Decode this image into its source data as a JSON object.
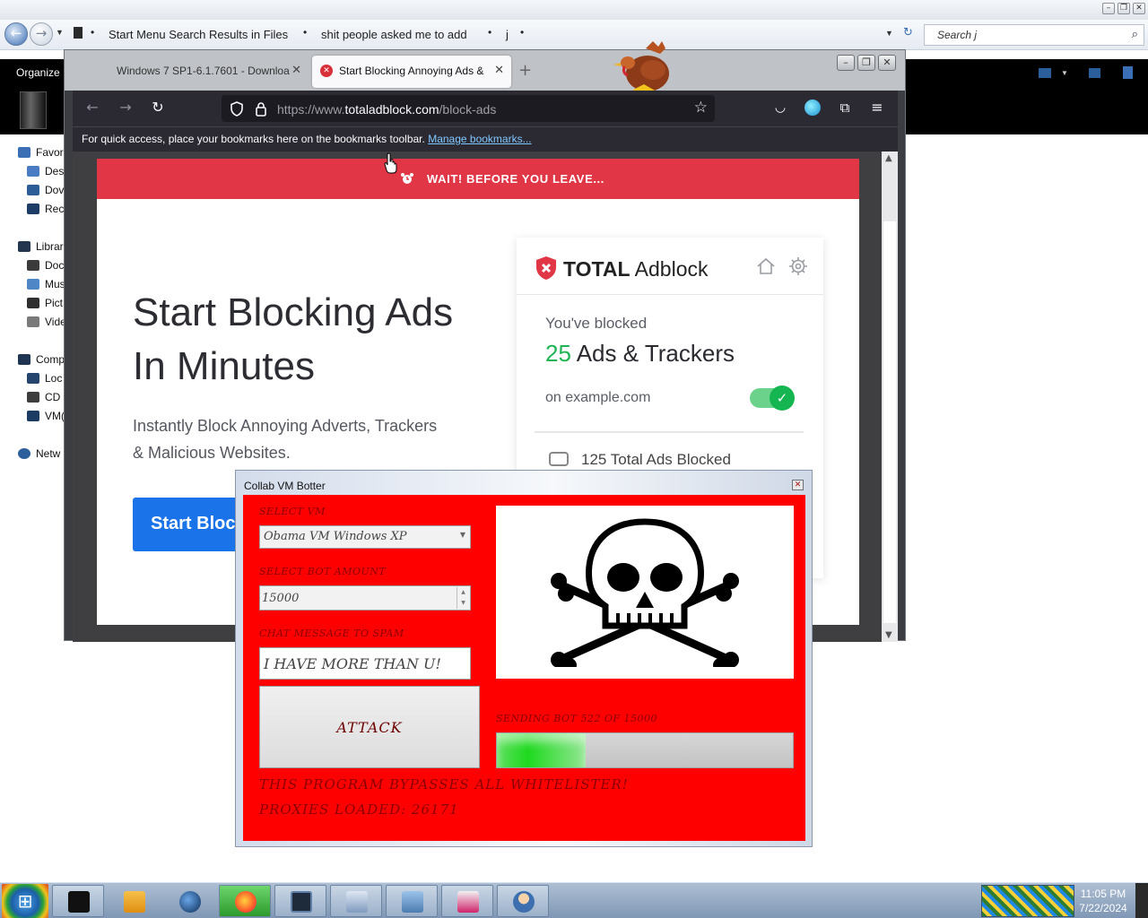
{
  "explorer": {
    "breadcrumbs": [
      "Start Menu Search Results in Files",
      "shit people asked me to add",
      "j"
    ],
    "search_placeholder": "Search j",
    "toolbar": {
      "organize_label": "Organize"
    },
    "nav_items": [
      {
        "label": "Favor",
        "color": "#3a6fb5"
      },
      {
        "label": "Des",
        "color": "#4a7cc4"
      },
      {
        "label": "Dov",
        "color": "#2d5d96"
      },
      {
        "label": "Rec",
        "color": "#1e3d66"
      },
      {
        "label": "Librar",
        "color": "#23354f"
      },
      {
        "label": "Doc",
        "color": "#3b3b3b"
      },
      {
        "label": "Mus",
        "color": "#4f86c6"
      },
      {
        "label": "Pict",
        "color": "#2f2f2f"
      },
      {
        "label": "Vide",
        "color": "#7a7a7a"
      },
      {
        "label": "Comp",
        "color": "#1f3552"
      },
      {
        "label": "Loc",
        "color": "#26456e"
      },
      {
        "label": "CD",
        "color": "#3d3d3d"
      },
      {
        "label": "VM(",
        "color": "#1b3b63"
      },
      {
        "label": "Netw",
        "color": "#2b5f9c"
      }
    ]
  },
  "firefox": {
    "tabs": [
      {
        "title": "Windows 7 SP1-6.1.7601 - Downloa"
      },
      {
        "title": "Start Blocking Annoying Ads &"
      }
    ],
    "url_prefix": "https://www.",
    "url_domain": "totaladblock.com",
    "url_path": "/block-ads",
    "bookmarks_text": "For quick access, place your bookmarks here on the bookmarks toolbar.",
    "manage_bookmarks": "Manage bookmarks..."
  },
  "webpage": {
    "banner": "WAIT! BEFORE YOU LEAVE...",
    "hero_title_line1": "Start Blocking Ads",
    "hero_title_line2": "In Minutes",
    "hero_sub_line1": "Instantly Block Annoying Adverts, Trackers",
    "hero_sub_line2": "& Malicious Websites.",
    "cta": "Start Blocking Ads",
    "panel": {
      "brand_bold": "TOTAL",
      "brand_light": "Adblock",
      "blocked_label": "You've blocked",
      "blocked_number": "25",
      "blocked_suffix": "Ads & Trackers",
      "site_label": "on example.com",
      "total_blocked": "125 Total Ads Blocked",
      "toggle_on": true
    }
  },
  "botter": {
    "title": "Collab VM Botter",
    "select_vm_label": "SELECT VM",
    "select_vm_value": "Obama VM Windows XP",
    "bot_amount_label": "SELECT BOT AMOUNT",
    "bot_amount_value": "15000",
    "chat_label": "CHAT MESSAGE TO SPAM",
    "chat_value": "I HAVE MORE THAN U!",
    "attack_label": "ATTACK",
    "sending_status": "SENDING BOT 522 OF 15000",
    "progress_fraction": 0.3,
    "bypass_text": "THIS PROGRAM BYPASSES ALL WHITELISTER!",
    "proxies_text": "PROXIES LOADED: 26171"
  },
  "taskbar": {
    "time": "11:05 PM",
    "date": "7/22/2024"
  },
  "colors": {
    "banner_red": "#e03646",
    "botter_red": "#ff0000",
    "cta_blue": "#1a73e8",
    "blocked_green": "#1fb454"
  }
}
